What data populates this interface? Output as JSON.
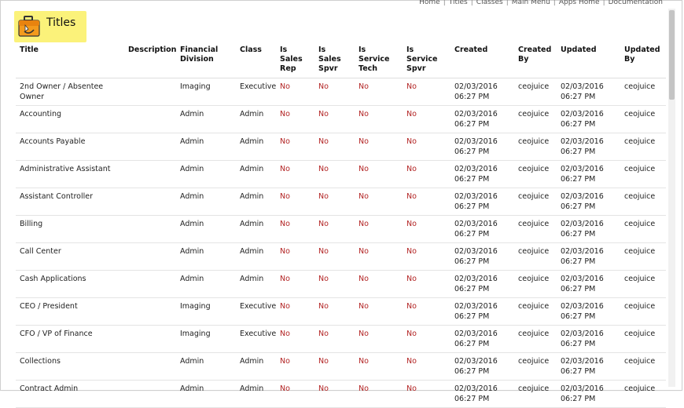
{
  "topnav": [
    "Home",
    "Titles",
    "Classes",
    "Main Menu",
    "Apps Home",
    "Documentation"
  ],
  "page": {
    "title": "Titles"
  },
  "table": {
    "headers": [
      "Title",
      "Description",
      "Financial Division",
      "Class",
      "Is Sales Rep",
      "Is Sales Spvr",
      "Is Service Tech",
      "Is Service Spvr",
      "Created",
      "Created By",
      "Updated",
      "Updated By"
    ],
    "rows": [
      {
        "title": "2nd Owner / Absentee Owner",
        "description": "",
        "division": "Imaging",
        "class": "Executive",
        "sales_rep": "No",
        "sales_spvr": "No",
        "service_tech": "No",
        "service_spvr": "No",
        "created_date": "02/03/2016",
        "created_time": "06:27 PM",
        "created_by": "ceojuice",
        "updated_date": "02/03/2016",
        "updated_time": "06:27 PM",
        "updated_by": "ceojuice"
      },
      {
        "title": "Accounting",
        "description": "",
        "division": "Admin",
        "class": "Admin",
        "sales_rep": "No",
        "sales_spvr": "No",
        "service_tech": "No",
        "service_spvr": "No",
        "created_date": "02/03/2016",
        "created_time": "06:27 PM",
        "created_by": "ceojuice",
        "updated_date": "02/03/2016",
        "updated_time": "06:27 PM",
        "updated_by": "ceojuice"
      },
      {
        "title": "Accounts Payable",
        "description": "",
        "division": "Admin",
        "class": "Admin",
        "sales_rep": "No",
        "sales_spvr": "No",
        "service_tech": "No",
        "service_spvr": "No",
        "created_date": "02/03/2016",
        "created_time": "06:27 PM",
        "created_by": "ceojuice",
        "updated_date": "02/03/2016",
        "updated_time": "06:27 PM",
        "updated_by": "ceojuice"
      },
      {
        "title": "Administrative Assistant",
        "description": "",
        "division": "Admin",
        "class": "Admin",
        "sales_rep": "No",
        "sales_spvr": "No",
        "service_tech": "No",
        "service_spvr": "No",
        "created_date": "02/03/2016",
        "created_time": "06:27 PM",
        "created_by": "ceojuice",
        "updated_date": "02/03/2016",
        "updated_time": "06:27 PM",
        "updated_by": "ceojuice"
      },
      {
        "title": "Assistant Controller",
        "description": "",
        "division": "Admin",
        "class": "Admin",
        "sales_rep": "No",
        "sales_spvr": "No",
        "service_tech": "No",
        "service_spvr": "No",
        "created_date": "02/03/2016",
        "created_time": "06:27 PM",
        "created_by": "ceojuice",
        "updated_date": "02/03/2016",
        "updated_time": "06:27 PM",
        "updated_by": "ceojuice"
      },
      {
        "title": "Billing",
        "description": "",
        "division": "Admin",
        "class": "Admin",
        "sales_rep": "No",
        "sales_spvr": "No",
        "service_tech": "No",
        "service_spvr": "No",
        "created_date": "02/03/2016",
        "created_time": "06:27 PM",
        "created_by": "ceojuice",
        "updated_date": "02/03/2016",
        "updated_time": "06:27 PM",
        "updated_by": "ceojuice"
      },
      {
        "title": "Call Center",
        "description": "",
        "division": "Admin",
        "class": "Admin",
        "sales_rep": "No",
        "sales_spvr": "No",
        "service_tech": "No",
        "service_spvr": "No",
        "created_date": "02/03/2016",
        "created_time": "06:27 PM",
        "created_by": "ceojuice",
        "updated_date": "02/03/2016",
        "updated_time": "06:27 PM",
        "updated_by": "ceojuice"
      },
      {
        "title": "Cash Applications",
        "description": "",
        "division": "Admin",
        "class": "Admin",
        "sales_rep": "No",
        "sales_spvr": "No",
        "service_tech": "No",
        "service_spvr": "No",
        "created_date": "02/03/2016",
        "created_time": "06:27 PM",
        "created_by": "ceojuice",
        "updated_date": "02/03/2016",
        "updated_time": "06:27 PM",
        "updated_by": "ceojuice"
      },
      {
        "title": "CEO / President",
        "description": "",
        "division": "Imaging",
        "class": "Executive",
        "sales_rep": "No",
        "sales_spvr": "No",
        "service_tech": "No",
        "service_spvr": "No",
        "created_date": "02/03/2016",
        "created_time": "06:27 PM",
        "created_by": "ceojuice",
        "updated_date": "02/03/2016",
        "updated_time": "06:27 PM",
        "updated_by": "ceojuice"
      },
      {
        "title": "CFO / VP of Finance",
        "description": "",
        "division": "Imaging",
        "class": "Executive",
        "sales_rep": "No",
        "sales_spvr": "No",
        "service_tech": "No",
        "service_spvr": "No",
        "created_date": "02/03/2016",
        "created_time": "06:27 PM",
        "created_by": "ceojuice",
        "updated_date": "02/03/2016",
        "updated_time": "06:27 PM",
        "updated_by": "ceojuice"
      },
      {
        "title": "Collections",
        "description": "",
        "division": "Admin",
        "class": "Admin",
        "sales_rep": "No",
        "sales_spvr": "No",
        "service_tech": "No",
        "service_spvr": "No",
        "created_date": "02/03/2016",
        "created_time": "06:27 PM",
        "created_by": "ceojuice",
        "updated_date": "02/03/2016",
        "updated_time": "06:27 PM",
        "updated_by": "ceojuice"
      },
      {
        "title": "Contract Admin",
        "description": "",
        "division": "Admin",
        "class": "Admin",
        "sales_rep": "No",
        "sales_spvr": "No",
        "service_tech": "No",
        "service_spvr": "No",
        "created_date": "02/03/2016",
        "created_time": "06:27 PM",
        "created_by": "ceojuice",
        "updated_date": "02/03/2016",
        "updated_time": "06:27 PM",
        "updated_by": "ceojuice"
      }
    ]
  },
  "colors": {
    "header_bg": "#fbf27a",
    "no_value": "#b22222"
  },
  "icons": {
    "page_icon": "briefcase-icon"
  }
}
